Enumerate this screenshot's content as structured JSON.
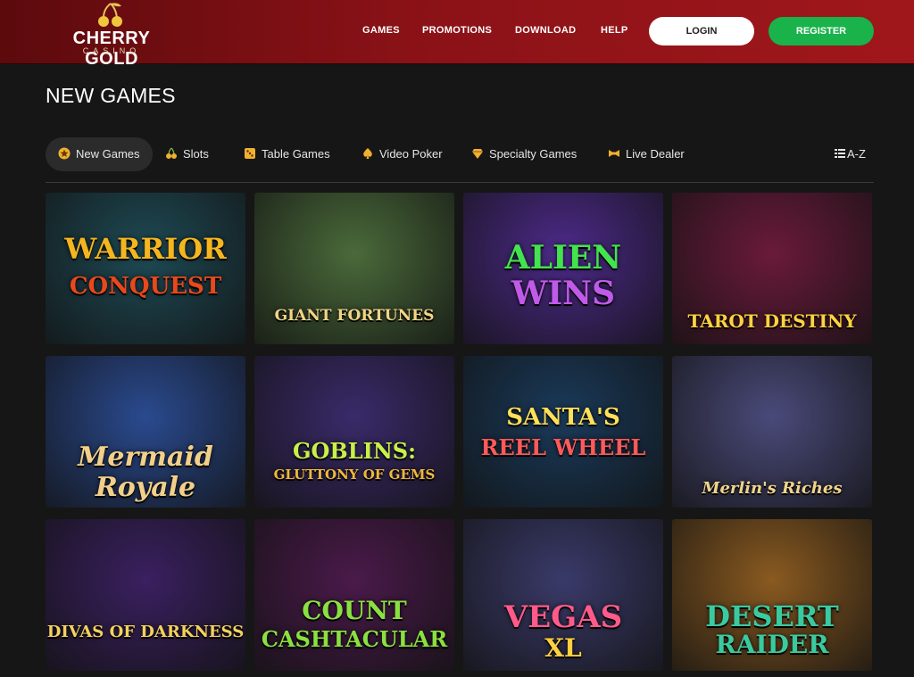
{
  "header": {
    "logo_text": "CHERRY GOLD",
    "logo_sub": "CASINO",
    "nav": [
      "GAMES",
      "PROMOTIONS",
      "DOWNLOAD",
      "HELP"
    ],
    "login_label": "LOGIN",
    "register_label": "REGISTER"
  },
  "page": {
    "title": "NEW GAMES"
  },
  "tabs": [
    {
      "label": "New Games",
      "icon": "star-badge-icon",
      "active": true
    },
    {
      "label": "Slots",
      "icon": "cherries-icon",
      "active": false
    },
    {
      "label": "Table Games",
      "icon": "dice-icon",
      "active": false
    },
    {
      "label": "Video Poker",
      "icon": "spade-icon",
      "active": false
    },
    {
      "label": "Specialty Games",
      "icon": "diamond-icon",
      "active": false
    },
    {
      "label": "Live Dealer",
      "icon": "bowtie-icon",
      "active": false
    }
  ],
  "az_label": "A-Z",
  "games": [
    {
      "line1": "WARRIOR",
      "line2": "CONQUEST",
      "bg": "#1e4a55",
      "c1": "#f5b51f",
      "c2": "#e9481d"
    },
    {
      "line1": "GIANT FORTUNES",
      "line2": "",
      "bg": "#4a6a3a",
      "c1": "#f2d487",
      "c2": "#f2d487"
    },
    {
      "line1": "ALIEN",
      "line2": "WINS",
      "bg": "#4d2a8a",
      "c1": "#43e34f",
      "c2": "#c05ae8"
    },
    {
      "line1": "TAROT DESTINY",
      "line2": "",
      "bg": "#6a1a3a",
      "c1": "#ffd23f",
      "c2": "#ffd23f"
    },
    {
      "line1": "Mermaid",
      "line2": "Royale",
      "bg": "#2a4a8f",
      "c1": "#f2d08a",
      "c2": "#f2d08a"
    },
    {
      "line1": "GOBLINS:",
      "line2": "GLUTTONY OF GEMS",
      "bg": "#3a2a6a",
      "c1": "#c8f04a",
      "c2": "#f0b83a"
    },
    {
      "line1": "SANTA'S",
      "line2": "REEL WHEEL",
      "bg": "#1a3a5a",
      "c1": "#ffe05a",
      "c2": "#ff5a5a"
    },
    {
      "line1": "Merlin's Riches",
      "line2": "",
      "bg": "#4a4a7a",
      "c1": "#f0d48a",
      "c2": "#f0d48a"
    },
    {
      "line1": "DIVAS OF DARKNESS",
      "line2": "",
      "bg": "#3a2060",
      "c1": "#f3d15e",
      "c2": "#f3d15e"
    },
    {
      "line1": "COUNT",
      "line2": "CASHTACULAR",
      "bg": "#4a1a4a",
      "c1": "#8ae040",
      "c2": "#8ae040"
    },
    {
      "line1": "VEGAS",
      "line2": "XL",
      "bg": "#3a3a6a",
      "c1": "#ff5a8a",
      "c2": "#ffd040"
    },
    {
      "line1": "DESERT",
      "line2": "RAIDER",
      "bg": "#8a5a20",
      "c1": "#3acaa0",
      "c2": "#3acaa0"
    }
  ],
  "colors": {
    "header": "#8a1217",
    "register": "#19b24b",
    "bg": "#161616"
  }
}
